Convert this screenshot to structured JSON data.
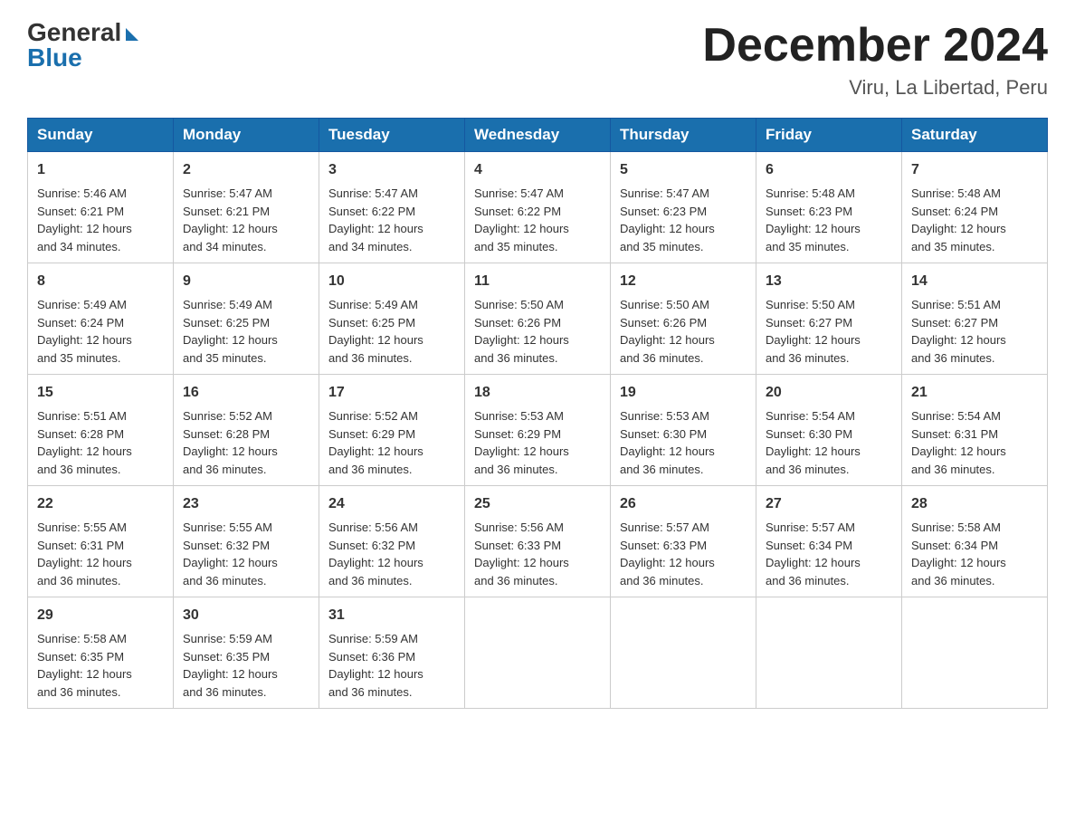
{
  "header": {
    "logo_general": "General",
    "logo_blue": "Blue",
    "month_year": "December 2024",
    "location": "Viru, La Libertad, Peru"
  },
  "weekdays": [
    "Sunday",
    "Monday",
    "Tuesday",
    "Wednesday",
    "Thursday",
    "Friday",
    "Saturday"
  ],
  "weeks": [
    [
      {
        "day": "1",
        "info": "Sunrise: 5:46 AM\nSunset: 6:21 PM\nDaylight: 12 hours\nand 34 minutes."
      },
      {
        "day": "2",
        "info": "Sunrise: 5:47 AM\nSunset: 6:21 PM\nDaylight: 12 hours\nand 34 minutes."
      },
      {
        "day": "3",
        "info": "Sunrise: 5:47 AM\nSunset: 6:22 PM\nDaylight: 12 hours\nand 34 minutes."
      },
      {
        "day": "4",
        "info": "Sunrise: 5:47 AM\nSunset: 6:22 PM\nDaylight: 12 hours\nand 35 minutes."
      },
      {
        "day": "5",
        "info": "Sunrise: 5:47 AM\nSunset: 6:23 PM\nDaylight: 12 hours\nand 35 minutes."
      },
      {
        "day": "6",
        "info": "Sunrise: 5:48 AM\nSunset: 6:23 PM\nDaylight: 12 hours\nand 35 minutes."
      },
      {
        "day": "7",
        "info": "Sunrise: 5:48 AM\nSunset: 6:24 PM\nDaylight: 12 hours\nand 35 minutes."
      }
    ],
    [
      {
        "day": "8",
        "info": "Sunrise: 5:49 AM\nSunset: 6:24 PM\nDaylight: 12 hours\nand 35 minutes."
      },
      {
        "day": "9",
        "info": "Sunrise: 5:49 AM\nSunset: 6:25 PM\nDaylight: 12 hours\nand 35 minutes."
      },
      {
        "day": "10",
        "info": "Sunrise: 5:49 AM\nSunset: 6:25 PM\nDaylight: 12 hours\nand 36 minutes."
      },
      {
        "day": "11",
        "info": "Sunrise: 5:50 AM\nSunset: 6:26 PM\nDaylight: 12 hours\nand 36 minutes."
      },
      {
        "day": "12",
        "info": "Sunrise: 5:50 AM\nSunset: 6:26 PM\nDaylight: 12 hours\nand 36 minutes."
      },
      {
        "day": "13",
        "info": "Sunrise: 5:50 AM\nSunset: 6:27 PM\nDaylight: 12 hours\nand 36 minutes."
      },
      {
        "day": "14",
        "info": "Sunrise: 5:51 AM\nSunset: 6:27 PM\nDaylight: 12 hours\nand 36 minutes."
      }
    ],
    [
      {
        "day": "15",
        "info": "Sunrise: 5:51 AM\nSunset: 6:28 PM\nDaylight: 12 hours\nand 36 minutes."
      },
      {
        "day": "16",
        "info": "Sunrise: 5:52 AM\nSunset: 6:28 PM\nDaylight: 12 hours\nand 36 minutes."
      },
      {
        "day": "17",
        "info": "Sunrise: 5:52 AM\nSunset: 6:29 PM\nDaylight: 12 hours\nand 36 minutes."
      },
      {
        "day": "18",
        "info": "Sunrise: 5:53 AM\nSunset: 6:29 PM\nDaylight: 12 hours\nand 36 minutes."
      },
      {
        "day": "19",
        "info": "Sunrise: 5:53 AM\nSunset: 6:30 PM\nDaylight: 12 hours\nand 36 minutes."
      },
      {
        "day": "20",
        "info": "Sunrise: 5:54 AM\nSunset: 6:30 PM\nDaylight: 12 hours\nand 36 minutes."
      },
      {
        "day": "21",
        "info": "Sunrise: 5:54 AM\nSunset: 6:31 PM\nDaylight: 12 hours\nand 36 minutes."
      }
    ],
    [
      {
        "day": "22",
        "info": "Sunrise: 5:55 AM\nSunset: 6:31 PM\nDaylight: 12 hours\nand 36 minutes."
      },
      {
        "day": "23",
        "info": "Sunrise: 5:55 AM\nSunset: 6:32 PM\nDaylight: 12 hours\nand 36 minutes."
      },
      {
        "day": "24",
        "info": "Sunrise: 5:56 AM\nSunset: 6:32 PM\nDaylight: 12 hours\nand 36 minutes."
      },
      {
        "day": "25",
        "info": "Sunrise: 5:56 AM\nSunset: 6:33 PM\nDaylight: 12 hours\nand 36 minutes."
      },
      {
        "day": "26",
        "info": "Sunrise: 5:57 AM\nSunset: 6:33 PM\nDaylight: 12 hours\nand 36 minutes."
      },
      {
        "day": "27",
        "info": "Sunrise: 5:57 AM\nSunset: 6:34 PM\nDaylight: 12 hours\nand 36 minutes."
      },
      {
        "day": "28",
        "info": "Sunrise: 5:58 AM\nSunset: 6:34 PM\nDaylight: 12 hours\nand 36 minutes."
      }
    ],
    [
      {
        "day": "29",
        "info": "Sunrise: 5:58 AM\nSunset: 6:35 PM\nDaylight: 12 hours\nand 36 minutes."
      },
      {
        "day": "30",
        "info": "Sunrise: 5:59 AM\nSunset: 6:35 PM\nDaylight: 12 hours\nand 36 minutes."
      },
      {
        "day": "31",
        "info": "Sunrise: 5:59 AM\nSunset: 6:36 PM\nDaylight: 12 hours\nand 36 minutes."
      },
      {
        "day": "",
        "info": ""
      },
      {
        "day": "",
        "info": ""
      },
      {
        "day": "",
        "info": ""
      },
      {
        "day": "",
        "info": ""
      }
    ]
  ]
}
